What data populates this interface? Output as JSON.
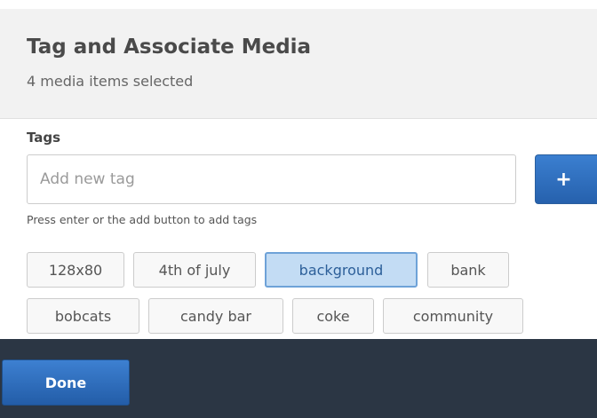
{
  "dialog": {
    "title": "Tag and Associate Media",
    "subtitle": "4 media items selected"
  },
  "tags_section": {
    "label": "Tags",
    "input_placeholder": "Add new tag",
    "input_value": "",
    "add_button_symbol": "+",
    "add_icon": "plus-icon",
    "help_text": "Press enter or the add button to add tags"
  },
  "tags": [
    {
      "label": "128x80",
      "selected": false
    },
    {
      "label": "4th of july",
      "selected": false
    },
    {
      "label": "background",
      "selected": true
    },
    {
      "label": "bank",
      "selected": false
    },
    {
      "label": "bobcats",
      "selected": false
    },
    {
      "label": "candy bar",
      "selected": false
    },
    {
      "label": "coke",
      "selected": false
    },
    {
      "label": "community",
      "selected": false
    }
  ],
  "footer": {
    "done_label": "Done"
  },
  "colors": {
    "primary_button": "#2e6dbf",
    "footer_background": "#2b3644",
    "selected_tag_background": "#c3dcf4",
    "selected_tag_border": "#6ea2d8"
  }
}
